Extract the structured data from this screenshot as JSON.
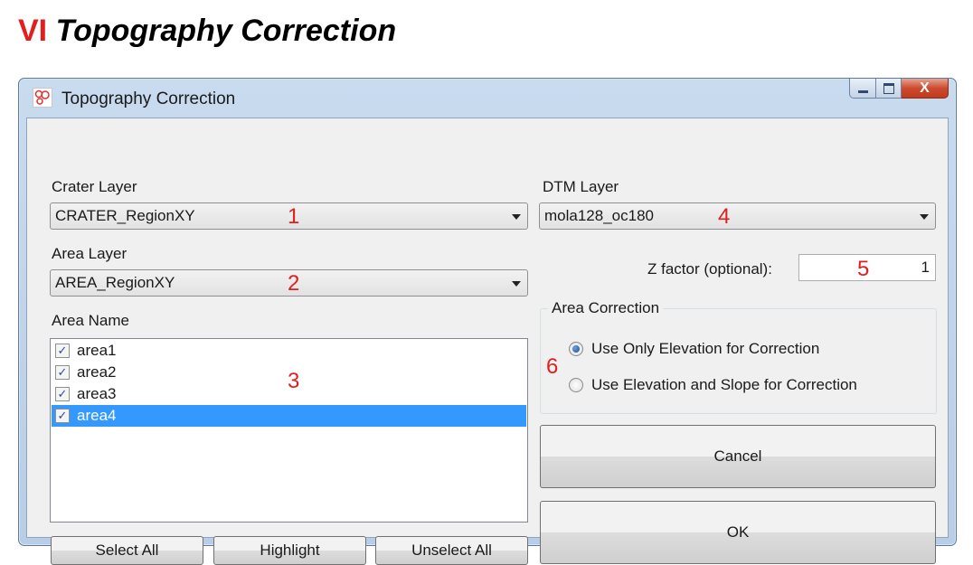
{
  "heading": {
    "number": "VI",
    "text": "Topography Correction"
  },
  "window": {
    "title": "Topography Correction",
    "close_glyph": "X"
  },
  "crater_layer": {
    "label": "Crater Layer",
    "value": "CRATER_RegionXY",
    "marker": "1"
  },
  "area_layer": {
    "label": "Area Layer",
    "value": "AREA_RegionXY",
    "marker": "2"
  },
  "area_name": {
    "label": "Area Name",
    "marker": "3",
    "items": [
      {
        "label": "area1",
        "checked": true,
        "selected": false
      },
      {
        "label": "area2",
        "checked": true,
        "selected": false
      },
      {
        "label": "area3",
        "checked": true,
        "selected": false
      },
      {
        "label": "area4",
        "checked": true,
        "selected": true
      }
    ],
    "check_glyph": "✓"
  },
  "list_buttons": {
    "select_all": "Select All",
    "highlight": "Highlight",
    "unselect_all": "Unselect All"
  },
  "dtm_layer": {
    "label": "DTM Layer",
    "value": "mola128_oc180",
    "marker": "4"
  },
  "z_factor": {
    "label": "Z factor (optional):",
    "value": "1",
    "marker": "5"
  },
  "area_correction": {
    "title": "Area Correction",
    "marker": "6",
    "options": [
      {
        "label": "Use Only Elevation for Correction",
        "selected": true
      },
      {
        "label": "Use Elevation and Slope for Correction",
        "selected": false
      }
    ]
  },
  "actions": {
    "cancel": "Cancel",
    "ok": "OK"
  },
  "colors": {
    "accent_red": "#e02020",
    "selection": "#3399ff"
  }
}
